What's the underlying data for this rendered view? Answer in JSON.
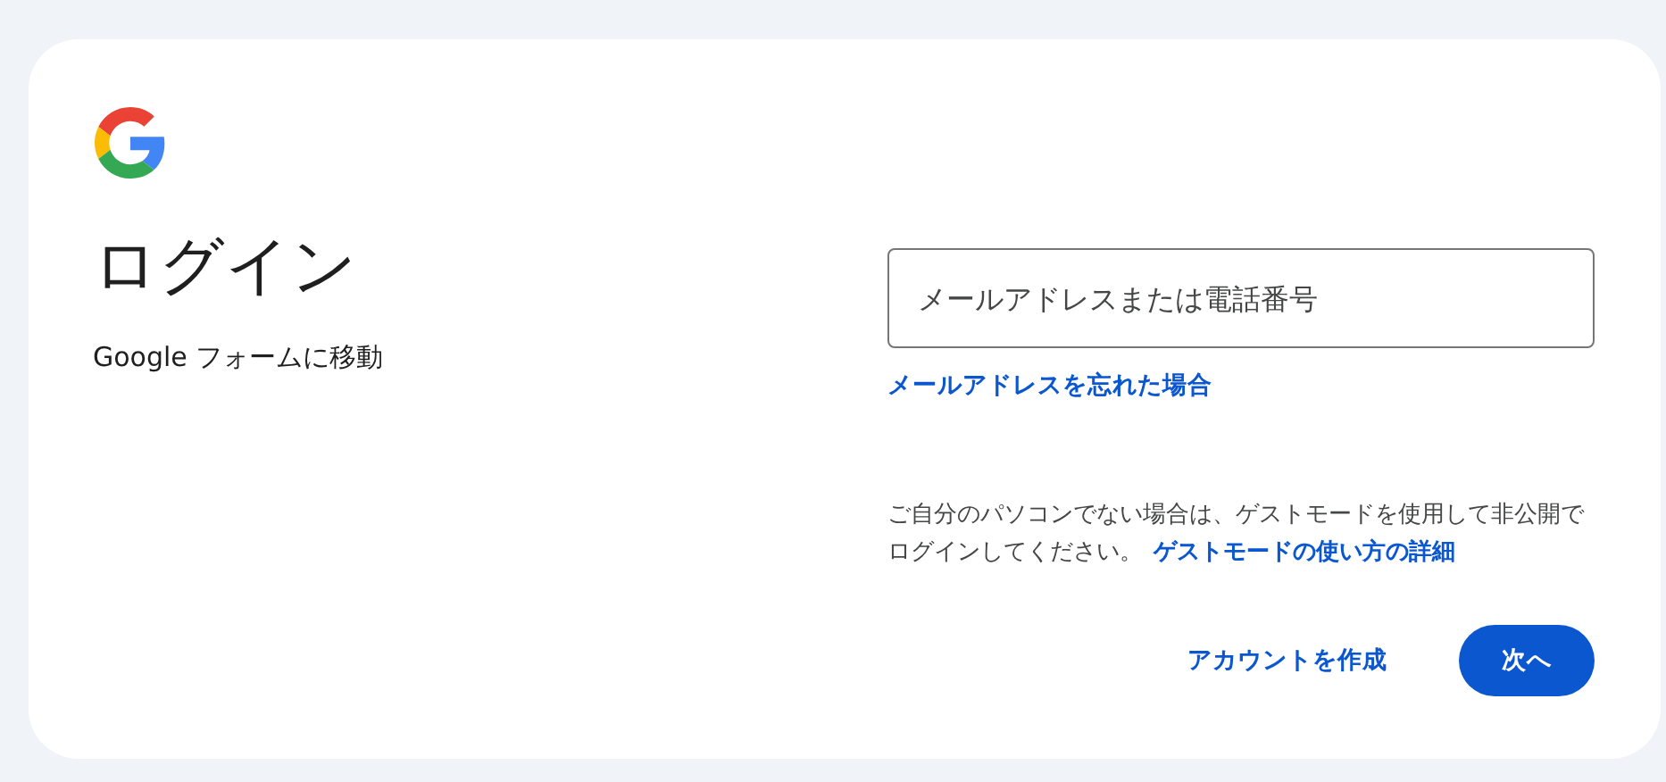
{
  "heading": "ログイン",
  "subtitle": "Google フォームに移動",
  "email_field": {
    "placeholder": "メールアドレスまたは電話番号"
  },
  "forgot_link": "メールアドレスを忘れた場合",
  "guest_notice": {
    "text": "ご自分のパソコンでない場合は、ゲストモードを使用して非公開でログインしてください。",
    "link": "ゲストモードの使い方の詳細"
  },
  "buttons": [
    {
      "kind": "text",
      "label": "アカウントを作成"
    },
    {
      "kind": "filled",
      "label": "次へ"
    }
  ]
}
